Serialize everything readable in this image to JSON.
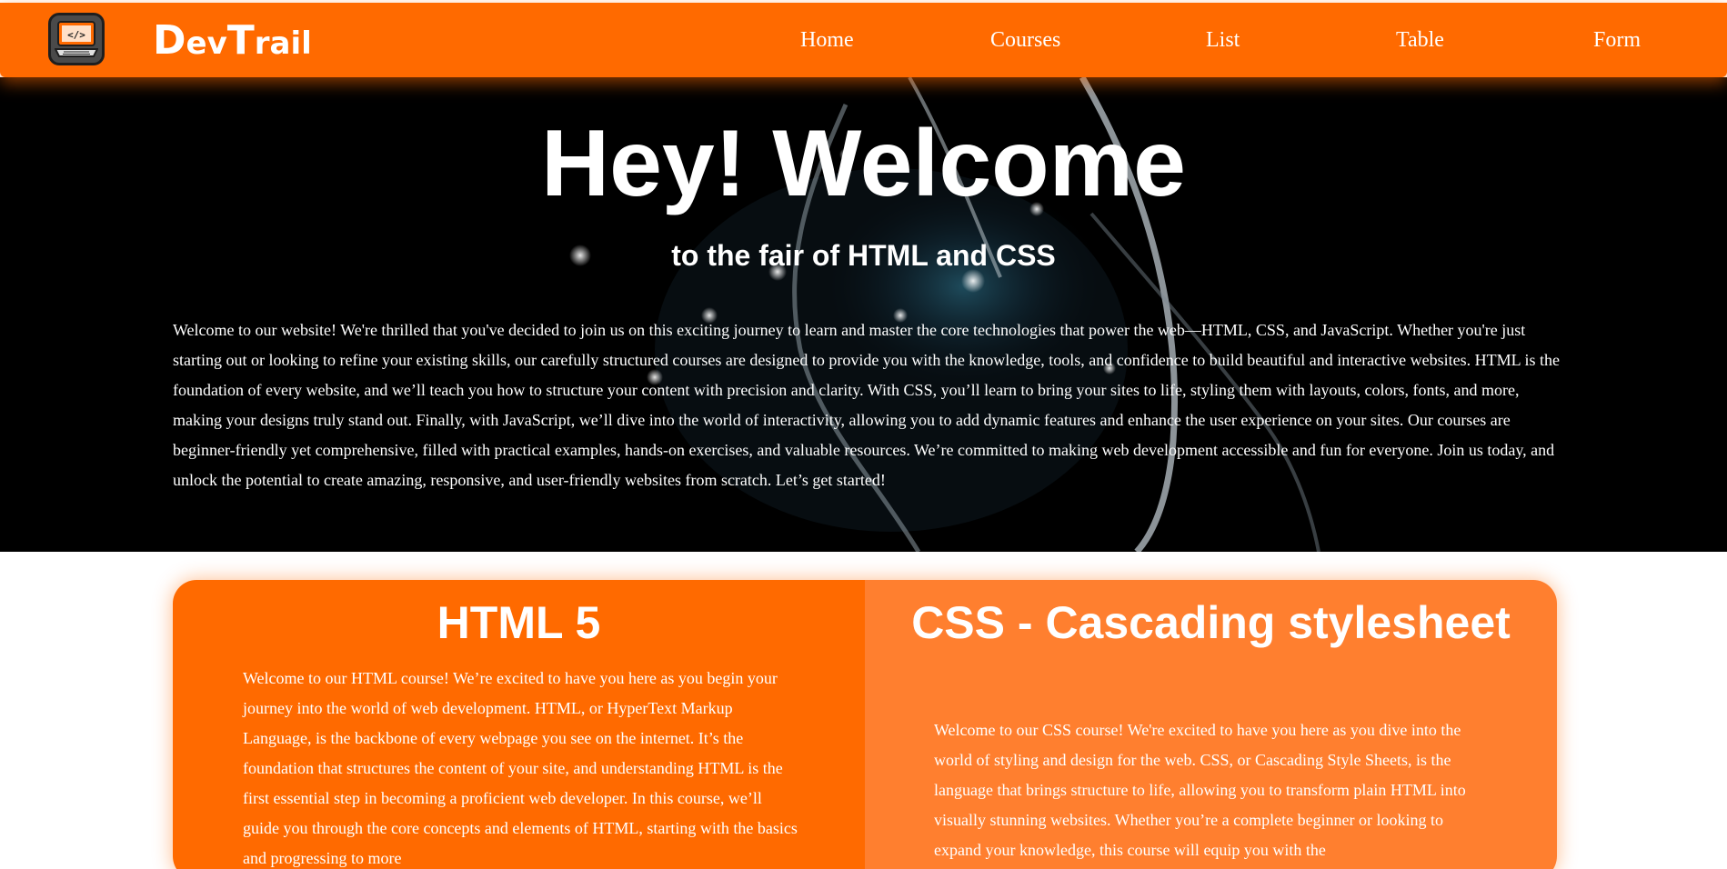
{
  "navbar": {
    "brand": {
      "d": "D",
      "ev": "ev",
      "t": "T",
      "rail": "rail"
    },
    "logo_icon": "laptop-code-icon",
    "links": [
      "Home",
      "Courses",
      "List",
      "Table",
      "Form"
    ]
  },
  "hero": {
    "title": "Hey! Welcome",
    "subtitle": "to the fair of HTML and CSS",
    "text": "Welcome to our website! We're thrilled that you've decided to join us on this exciting journey to learn and master the core technologies that power the web—HTML, CSS, and JavaScript. Whether you're just starting out or looking to refine your existing skills, our carefully structured courses are designed to provide you with the knowledge, tools, and confidence to build beautiful and interactive websites. HTML is the foundation of every website, and we’ll teach you how to structure your content with precision and clarity. With CSS, you’ll learn to bring your sites to life, styling them with layouts, colors, fonts, and more, making your designs truly stand out. Finally, with JavaScript, we’ll dive into the world of interactivity, allowing you to add dynamic features and enhance the user experience on your sites. Our courses are beginner-friendly yet comprehensive, filled with practical examples, hands-on exercises, and valuable resources. We’re committed to making web development accessible and fun for everyone. Join us today, and unlock the potential to create amazing, responsive, and user-friendly websites from scratch. Let’s get started!"
  },
  "courses": [
    {
      "title": "HTML 5",
      "text": "Welcome to our HTML course! We’re excited to have you here as you begin your journey into the world of web development. HTML, or HyperText Markup Language, is the backbone of every webpage you see on the internet. It’s the foundation that structures the content of your site, and understanding HTML is the first essential step in becoming a proficient web developer. In this course, we’ll guide you through the core concepts and elements of HTML, starting with the basics and progressing to more"
    },
    {
      "title": "CSS - Cascading stylesheet",
      "text": "Welcome to our CSS course! We're excited to have you here as you dive into the world of styling and design for the web. CSS, or Cascading Style Sheets, is the language that brings structure to life, allowing you to transform plain HTML into visually stunning websites. Whether you’re a complete beginner or looking to expand your knowledge, this course will equip you with the"
    }
  ],
  "colors": {
    "primary": "#ff6a00",
    "secondary": "#ff7f2f",
    "hero_bg": "#000000"
  }
}
